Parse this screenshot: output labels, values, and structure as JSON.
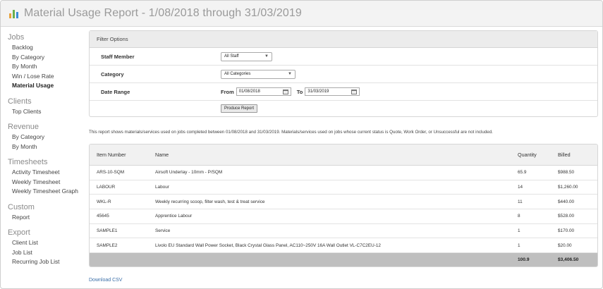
{
  "header": {
    "title": "Material Usage Report - 1/08/2018 through 31/03/2019"
  },
  "sidebar": {
    "sections": [
      {
        "heading": "Jobs",
        "items": [
          "Backlog",
          "By Category",
          "By Month",
          "Win / Lose Rate",
          "Material Usage"
        ]
      },
      {
        "heading": "Clients",
        "items": [
          "Top Clients"
        ]
      },
      {
        "heading": "Revenue",
        "items": [
          "By Category",
          "By Month"
        ]
      },
      {
        "heading": "Timesheets",
        "items": [
          "Activity Timesheet",
          "Weekly Timesheet",
          "Weekly Timesheet Graph"
        ]
      },
      {
        "heading": "Custom",
        "items": [
          "Report"
        ]
      },
      {
        "heading": "Export",
        "items": [
          "Client List",
          "Job List",
          "Recurring Job List"
        ]
      }
    ],
    "active_item": "Material Usage"
  },
  "filter": {
    "title": "Filter Options",
    "staff_label": "Staff Member",
    "staff_value": "All Staff",
    "category_label": "Category",
    "category_value": "All Categories",
    "date_label": "Date Range",
    "from_label": "From",
    "from_value": "01/08/2018",
    "to_label": "To",
    "to_value": "31/03/2019",
    "button_label": "Produce Report"
  },
  "note": "This report shows materials/services used on jobs completed between 01/08/2018 and 31/03/2019. Materials/services used on jobs whose current status is Quote, Work Order, or Unsuccessful are not included.",
  "table": {
    "headers": [
      "Item Number",
      "Name",
      "Quantity",
      "Billed"
    ],
    "rows": [
      [
        "ARS-10-SQM",
        "Airsoft Underlay - 10mm - P/SQM",
        "65.9",
        "$988.50"
      ],
      [
        "LABOUR",
        "Labour",
        "14",
        "$1,260.00"
      ],
      [
        "WKL-R",
        "Weekly recurring scoop, filter wash, test & treat service",
        "11",
        "$440.00"
      ],
      [
        "45645",
        "Apprentice Labour",
        "8",
        "$528.00"
      ],
      [
        "SAMPLE1",
        "Service",
        "1",
        "$170.00"
      ],
      [
        "SAMPLE2",
        "Livolo EU Standard Wall Power Socket, Black Crystal Glass Panel, AC110~250V 16A Wall Outlet VL-C7C2EU-12",
        "1",
        "$20.00"
      ]
    ],
    "total_quantity": "100.9",
    "total_billed": "$3,406.50"
  },
  "download_label": "Download CSV",
  "colors": {
    "logo_bar_1": "#e8a33b",
    "logo_bar_2": "#6ab04c",
    "logo_bar_3": "#3b8ed8",
    "link": "#3b6fa8",
    "footer_bg": "#bfbfbf"
  }
}
